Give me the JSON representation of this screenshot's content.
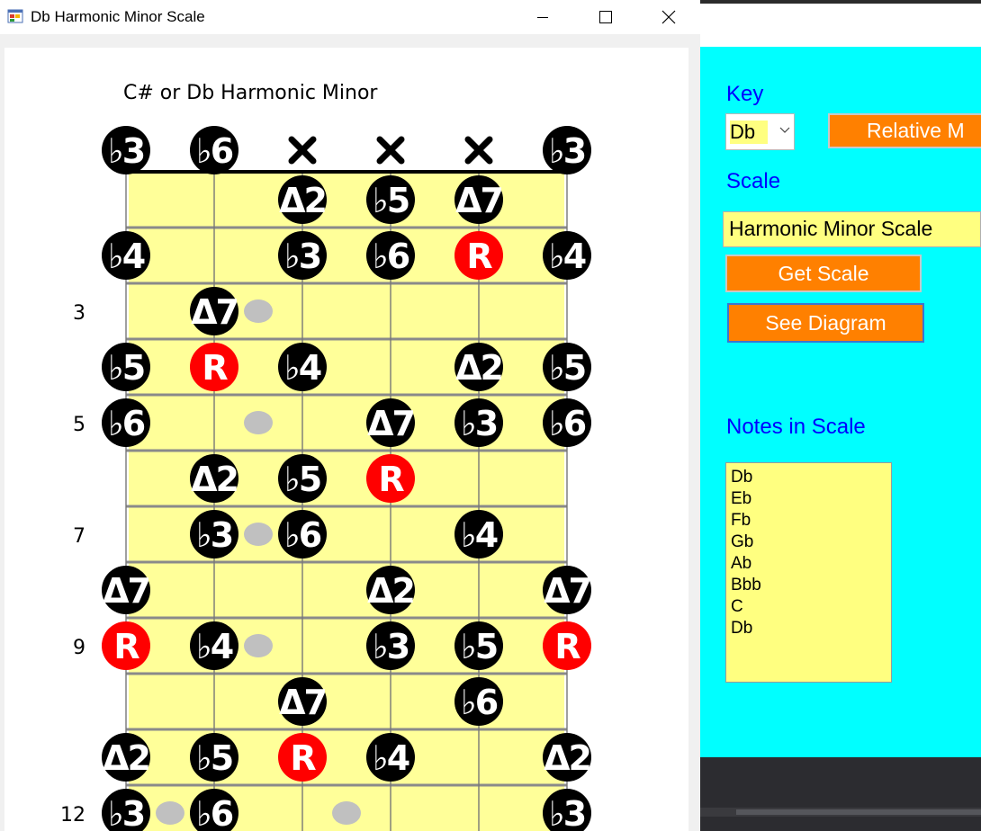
{
  "diagram_window": {
    "title": "Db Harmonic Minor Scale",
    "icon": "app-icon",
    "controls": [
      "minimize-icon",
      "maximize-icon",
      "close-icon"
    ]
  },
  "diagram": {
    "heading": "C# or Db Harmonic Minor",
    "strings": 6,
    "frets_shown": 12,
    "fret_numbers": [
      {
        "fret": 3,
        "label": "3"
      },
      {
        "fret": 5,
        "label": "5"
      },
      {
        "fret": 7,
        "label": "7"
      },
      {
        "fret": 9,
        "label": "9"
      },
      {
        "fret": 12,
        "label": "12"
      }
    ],
    "open_strings": [
      "♭3",
      "♭6",
      "✕",
      "✕",
      "✕",
      "♭3"
    ],
    "inlay_markers": [
      {
        "fret": 3,
        "between": 2.5
      },
      {
        "fret": 5,
        "between": 2.5
      },
      {
        "fret": 7,
        "between": 2.5
      },
      {
        "fret": 9,
        "between": 2.5
      },
      {
        "fret": 12,
        "between": 1.5
      },
      {
        "fret": 12,
        "between": 3.5
      }
    ],
    "notes": [
      {
        "fret": 1,
        "string": 3,
        "label": "Δ2"
      },
      {
        "fret": 1,
        "string": 4,
        "label": "♭5"
      },
      {
        "fret": 1,
        "string": 5,
        "label": "Δ7"
      },
      {
        "fret": 2,
        "string": 1,
        "label": "♭4"
      },
      {
        "fret": 2,
        "string": 3,
        "label": "♭3"
      },
      {
        "fret": 2,
        "string": 4,
        "label": "♭6"
      },
      {
        "fret": 2,
        "string": 5,
        "label": "R"
      },
      {
        "fret": 2,
        "string": 6,
        "label": "♭4"
      },
      {
        "fret": 3,
        "string": 2,
        "label": "Δ7"
      },
      {
        "fret": 4,
        "string": 1,
        "label": "♭5"
      },
      {
        "fret": 4,
        "string": 2,
        "label": "R"
      },
      {
        "fret": 4,
        "string": 3,
        "label": "♭4"
      },
      {
        "fret": 4,
        "string": 5,
        "label": "Δ2"
      },
      {
        "fret": 4,
        "string": 6,
        "label": "♭5"
      },
      {
        "fret": 5,
        "string": 1,
        "label": "♭6"
      },
      {
        "fret": 5,
        "string": 4,
        "label": "Δ7"
      },
      {
        "fret": 5,
        "string": 5,
        "label": "♭3"
      },
      {
        "fret": 5,
        "string": 6,
        "label": "♭6"
      },
      {
        "fret": 6,
        "string": 2,
        "label": "Δ2"
      },
      {
        "fret": 6,
        "string": 3,
        "label": "♭5"
      },
      {
        "fret": 6,
        "string": 4,
        "label": "R"
      },
      {
        "fret": 7,
        "string": 2,
        "label": "♭3"
      },
      {
        "fret": 7,
        "string": 3,
        "label": "♭6"
      },
      {
        "fret": 7,
        "string": 5,
        "label": "♭4"
      },
      {
        "fret": 8,
        "string": 1,
        "label": "Δ7"
      },
      {
        "fret": 8,
        "string": 4,
        "label": "Δ2"
      },
      {
        "fret": 8,
        "string": 6,
        "label": "Δ7"
      },
      {
        "fret": 9,
        "string": 1,
        "label": "R"
      },
      {
        "fret": 9,
        "string": 2,
        "label": "♭4"
      },
      {
        "fret": 9,
        "string": 4,
        "label": "♭3"
      },
      {
        "fret": 9,
        "string": 5,
        "label": "♭5"
      },
      {
        "fret": 9,
        "string": 6,
        "label": "R"
      },
      {
        "fret": 10,
        "string": 3,
        "label": "Δ7"
      },
      {
        "fret": 10,
        "string": 5,
        "label": "♭6"
      },
      {
        "fret": 11,
        "string": 1,
        "label": "Δ2"
      },
      {
        "fret": 11,
        "string": 2,
        "label": "♭5"
      },
      {
        "fret": 11,
        "string": 3,
        "label": "R"
      },
      {
        "fret": 11,
        "string": 4,
        "label": "♭4"
      },
      {
        "fret": 11,
        "string": 6,
        "label": "Δ2"
      },
      {
        "fret": 12,
        "string": 1,
        "label": "♭3"
      },
      {
        "fret": 12,
        "string": 2,
        "label": "♭6"
      },
      {
        "fret": 12,
        "string": 6,
        "label": "♭3"
      }
    ],
    "colors": {
      "fretboard": "#ffff99",
      "note": "#000000",
      "root": "#ff0000",
      "inlay": "#c0c0c0"
    }
  },
  "form": {
    "key_label": "Key",
    "key_value": "Db",
    "relative_button": "Relative M",
    "scale_label": "Scale",
    "scale_value": "Harmonic Minor Scale",
    "get_scale_button": "Get Scale",
    "see_diagram_button": "See Diagram",
    "notes_label": "Notes in Scale",
    "notes": [
      "Db",
      "Eb",
      "Fb",
      "Gb",
      "Ab",
      "Bbb",
      "C",
      "Db"
    ],
    "colors": {
      "background": "#00ffff",
      "button": "#ff8000",
      "field": "#ffff80",
      "label": "#0000ff"
    }
  }
}
